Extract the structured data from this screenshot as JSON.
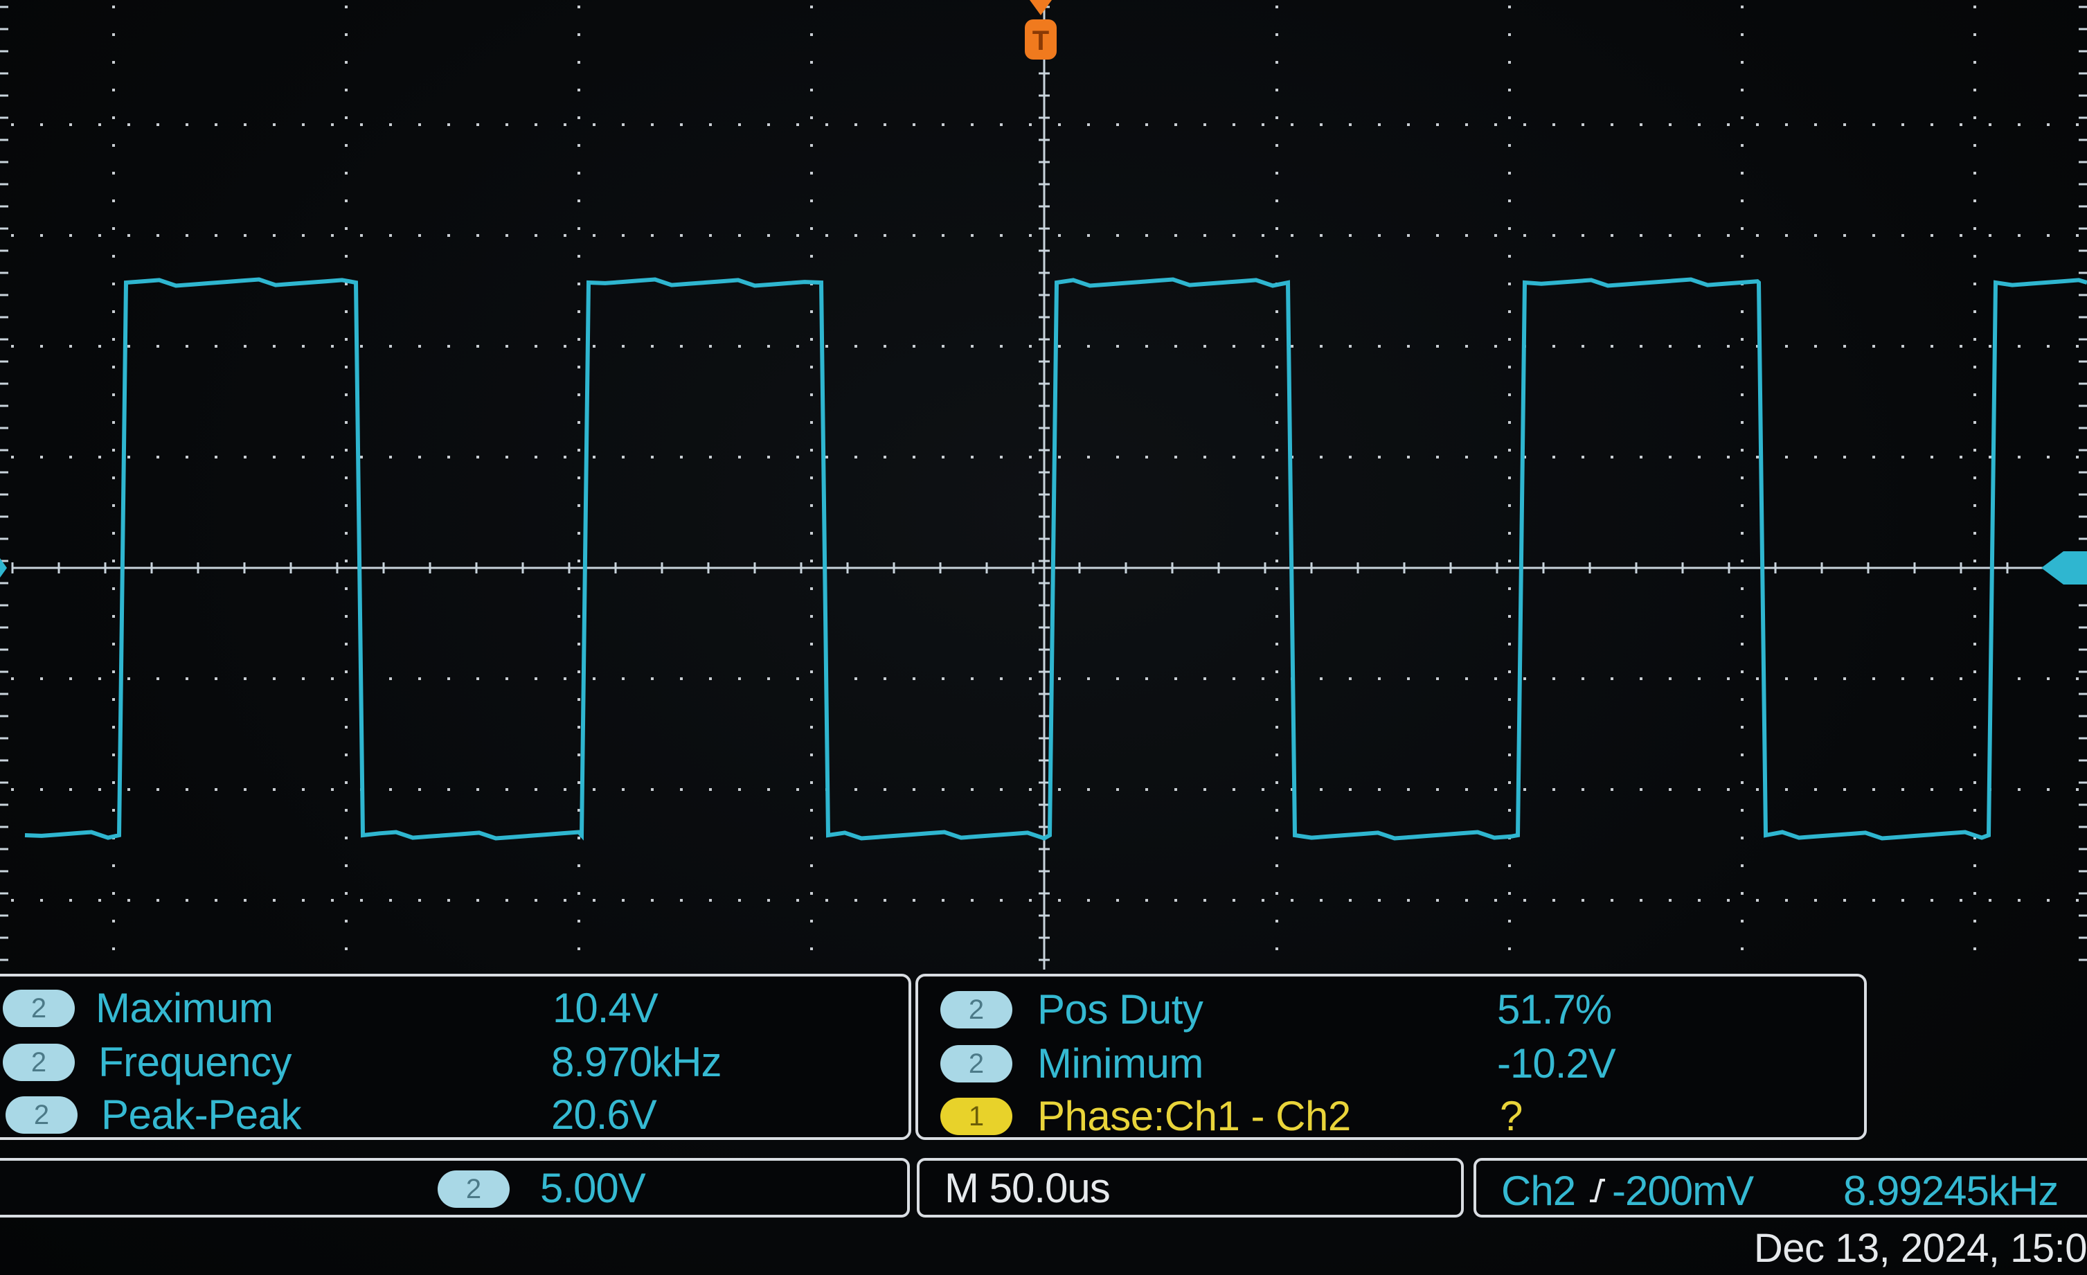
{
  "measurements_left": [
    {
      "channel": "2",
      "name": "Maximum",
      "value": "10.4V"
    },
    {
      "channel": "2",
      "name": "Frequency",
      "value": "8.970kHz"
    },
    {
      "channel": "2",
      "name": "Peak-Peak",
      "value": "20.6V"
    }
  ],
  "measurements_right": [
    {
      "channel": "2",
      "name": "Pos Duty",
      "value": "51.7%"
    },
    {
      "channel": "2",
      "name": "Minimum",
      "value": "-10.2V"
    },
    {
      "channel": "1",
      "name": "Phase:Ch1 - Ch2",
      "value": "?"
    }
  ],
  "status": {
    "vertical_channel": "2",
    "vertical_scale": "5.00V",
    "timebase": "M 50.0us",
    "trigger_source": "Ch2",
    "trigger_slope_icon": "rising-edge-icon",
    "trigger_level": "-200mV",
    "trigger_frequency": "8.99245kHz"
  },
  "date": "Dec 13, 2024, 15:0",
  "colors": {
    "trace": "#2fb6d0",
    "grid": "#c9ced3",
    "trigger_marker": "#f07a1e",
    "ch1": "#e8d22a",
    "ch2_badge": "#a9d8e6",
    "label_text": "#35b9d2",
    "yellow_text": "#e9d43a"
  }
}
